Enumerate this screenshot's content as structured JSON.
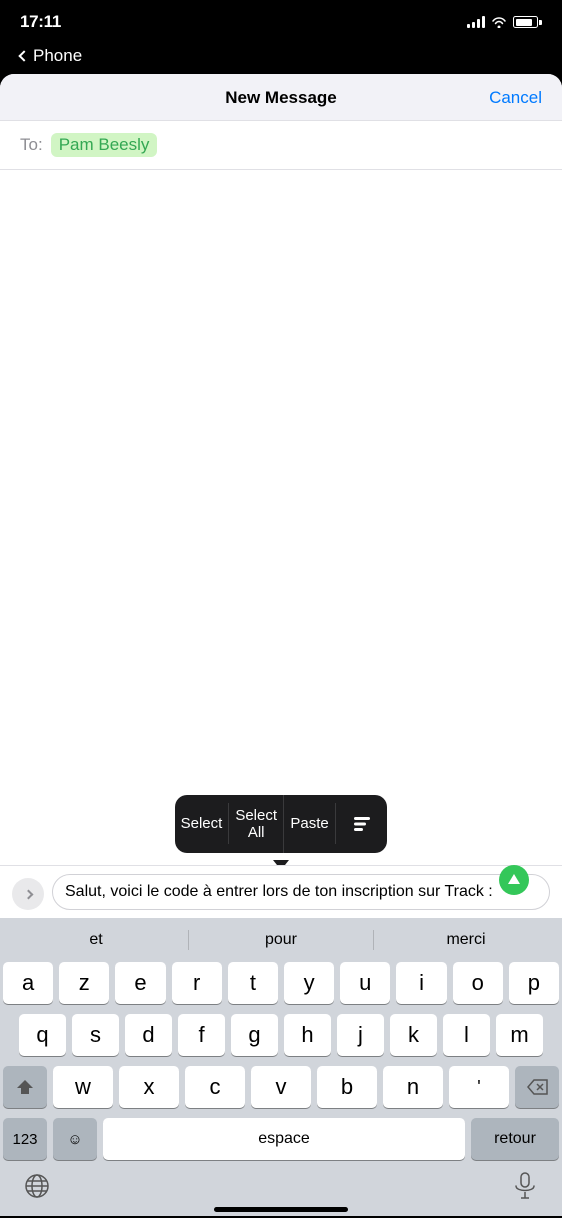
{
  "statusBar": {
    "time": "17:11",
    "backLabel": "Phone"
  },
  "header": {
    "title": "New Message",
    "cancelLabel": "Cancel"
  },
  "toField": {
    "label": "To:",
    "recipient": "Pam Beesly"
  },
  "contextMenu": {
    "items": [
      "Select",
      "Select All",
      "Paste"
    ],
    "hasFormatButton": true
  },
  "messageInput": {
    "text": "Salut, voici le code à entrer lors de ton inscription sur Track :"
  },
  "predictive": {
    "items": [
      "et",
      "pour",
      "merci"
    ]
  },
  "keyboard": {
    "rows": [
      [
        "a",
        "z",
        "e",
        "r",
        "t",
        "y",
        "u",
        "i",
        "o",
        "p"
      ],
      [
        "q",
        "s",
        "d",
        "f",
        "g",
        "h",
        "j",
        "k",
        "l",
        "m"
      ],
      [
        "w",
        "x",
        "c",
        "v",
        "b",
        "n",
        "'"
      ]
    ],
    "bottomRow": {
      "numbers": "123",
      "emoji": "☺",
      "space": "espace",
      "return": "retour"
    }
  }
}
